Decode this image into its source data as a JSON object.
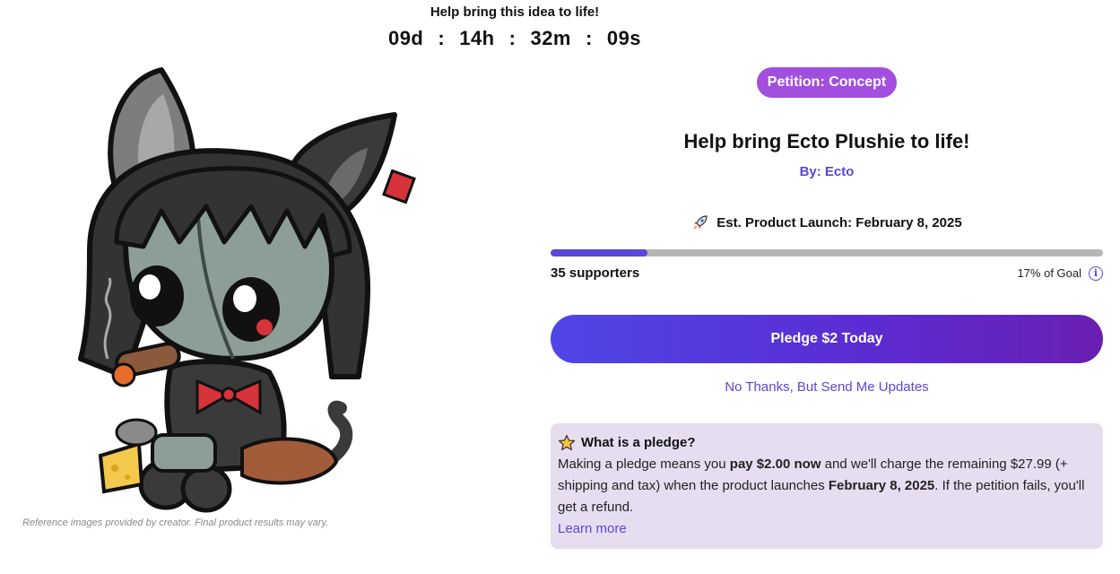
{
  "countdown": {
    "heading": "Help bring this idea to life!",
    "days": "09d",
    "hours": "14h",
    "minutes": "32m",
    "seconds": "09s",
    "separator": ":"
  },
  "image": {
    "disclaimer": "Reference images provided by creator. Final product results may vary."
  },
  "campaign": {
    "badge": "Petition: Concept",
    "title": "Help bring Ecto Plushie to life!",
    "byline": "By: Ecto",
    "launch_label": "Est. Product Launch: February 8, 2025",
    "launch_icon": "rocket-icon",
    "progress_fraction": 0.175,
    "supporters": "35 supporters",
    "goal": "17% of Goal",
    "pledge_button": "Pledge $2 Today",
    "no_thanks": "No Thanks, But Send Me Updates"
  },
  "pledge_info": {
    "icon": "star-icon",
    "heading": "What is a pledge?",
    "text_1": "Making a pledge means you ",
    "text_bold_1": "pay $2.00 now",
    "text_2": " and we'll charge the remaining $27.99 (+ shipping and tax) when the product launches ",
    "text_bold_2": "February 8, 2025",
    "text_3": ". If the petition fails, you'll get a refund.",
    "learn_more": "Learn more"
  },
  "colors": {
    "accent": "#5a46d8",
    "badge": "#a24fe0",
    "infobox_bg": "#e6ddf1",
    "progress_track": "#b5b5b5"
  }
}
